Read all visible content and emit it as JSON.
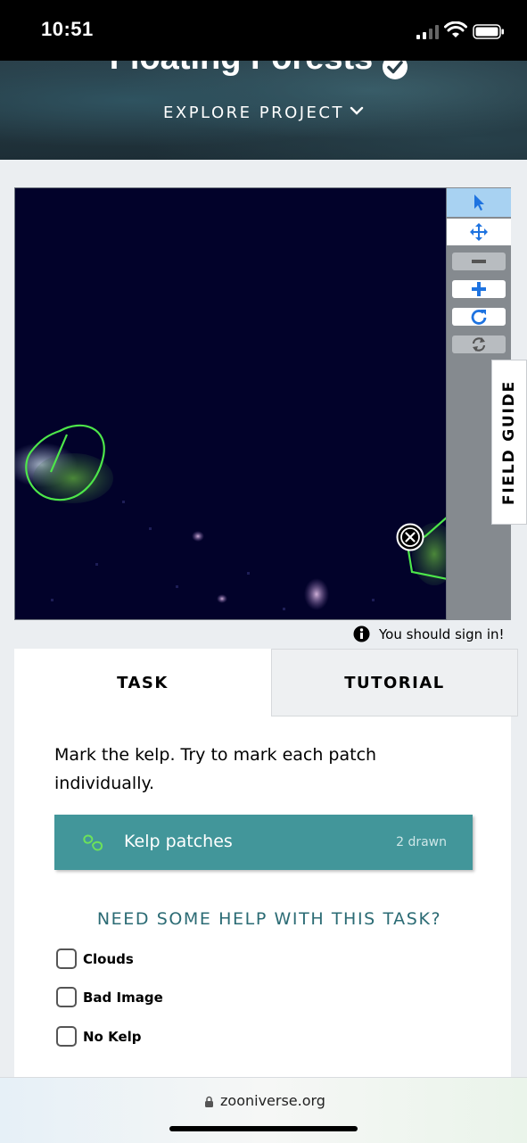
{
  "status_bar": {
    "time": "10:51"
  },
  "header": {
    "title": "Floating Forests",
    "explore_label": "EXPLORE PROJECT"
  },
  "toolbar": {
    "tools": [
      "select-icon",
      "move-icon",
      "zoom-out-icon",
      "zoom-in-icon",
      "rotate-icon",
      "reset-icon"
    ]
  },
  "field_guide": {
    "label": "FIELD GUIDE"
  },
  "signin_notice": "You should sign in!",
  "tabs": {
    "task": "TASK",
    "tutorial": "TUTORIAL"
  },
  "task": {
    "instruction": "Mark the kelp. Try to mark each patch individually.",
    "tool_label": "Kelp patches",
    "tool_count": "2 drawn",
    "help_label": "NEED SOME HELP WITH THIS TASK?",
    "options": [
      "Clouds",
      "Bad Image",
      "No Kelp"
    ]
  },
  "browser": {
    "url": "zooniverse.org"
  },
  "colors": {
    "kelp_outline": "#4de64a",
    "task_button": "#42969a",
    "help_link": "#2b6b74",
    "active_tool": "#a8d2f2"
  }
}
